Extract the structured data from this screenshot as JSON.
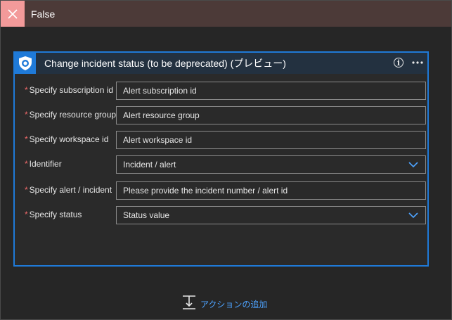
{
  "branch": {
    "title": "False",
    "close_icon": "close-icon",
    "header_color": "#4c3a38",
    "close_color": "#f39a9a"
  },
  "card": {
    "title": "Change incident status (to be deprecated) (プレビュー)",
    "app_icon": "sentinel-shield-icon",
    "info_icon": "info-icon",
    "more_icon": "more-icon",
    "accent": "#1f7ad8",
    "fields": [
      {
        "label": "Specify subscription id",
        "value": "Alert subscription id",
        "type": "text"
      },
      {
        "label": "Specify resource group",
        "value": "Alert resource group",
        "type": "text"
      },
      {
        "label": "Specify workspace id",
        "value": "Alert workspace id",
        "type": "text"
      },
      {
        "label": "Identifier",
        "value": "Incident / alert",
        "type": "dropdown"
      },
      {
        "label": "Specify alert / incident",
        "value": "Please provide the incident number / alert id",
        "type": "text"
      },
      {
        "label": "Specify status",
        "value": "Status value",
        "type": "dropdown"
      }
    ],
    "required_marker": "*"
  },
  "add_action": {
    "label": "アクションの追加",
    "icon": "add-action-icon"
  }
}
